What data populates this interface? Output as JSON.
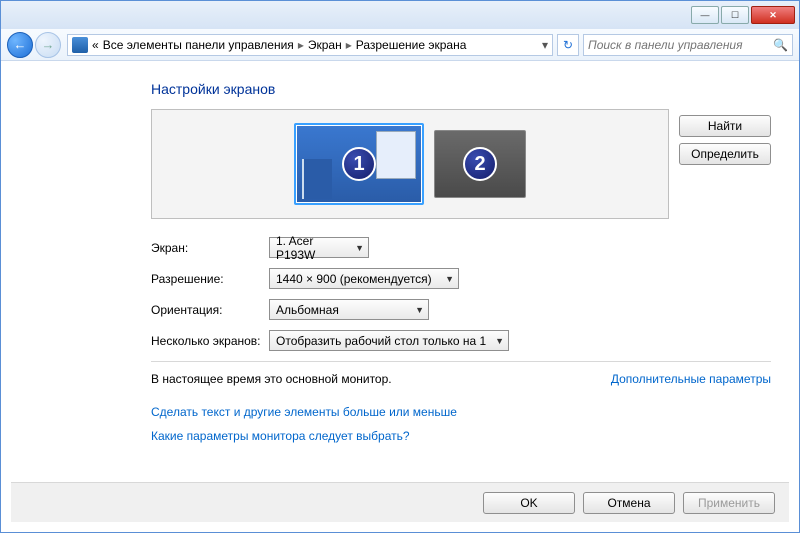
{
  "nav": {
    "breadcrumb_prefix": "«",
    "breadcrumb_root": "Все элементы панели управления",
    "breadcrumb_mid": "Экран",
    "breadcrumb_leaf": "Разрешение экрана",
    "search_placeholder": "Поиск в панели управления"
  },
  "heading": "Настройки экранов",
  "buttons": {
    "find": "Найти",
    "identify": "Определить",
    "ok": "OK",
    "cancel": "Отмена",
    "apply": "Применить"
  },
  "monitors": {
    "one": "1",
    "two": "2"
  },
  "labels": {
    "screen": "Экран:",
    "resolution": "Разрешение:",
    "orientation": "Ориентация:",
    "multi": "Несколько экранов:"
  },
  "values": {
    "screen": "1. Acer P193W",
    "resolution": "1440 × 900 (рекомендуется)",
    "orientation": "Альбомная",
    "multi": "Отобразить рабочий стол только на 1"
  },
  "status": "В настоящее время это основной монитор.",
  "links": {
    "advanced": "Дополнительные параметры",
    "textsize": "Сделать текст и другие элементы больше или меньше",
    "which": "Какие параметры монитора следует выбрать?"
  }
}
